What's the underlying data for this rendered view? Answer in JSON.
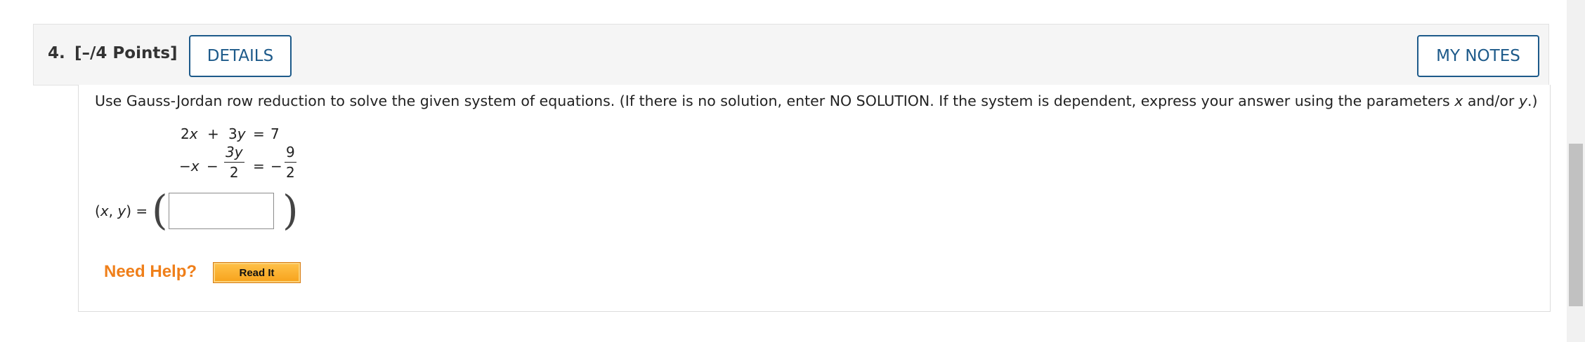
{
  "question": {
    "number": "4.",
    "points": "[–/4 Points]",
    "details_label": "DETAILS",
    "my_notes_label": "MY NOTES",
    "prompt_part1": "Use Gauss-Jordan row reduction to solve the given system of equations. (If there is no solution, enter NO SOLUTION. If the system is dependent, express your answer using the parameters ",
    "param_x": "x",
    "prompt_and_or": " and/or ",
    "param_y": "y",
    "prompt_end": ".)"
  },
  "system": {
    "eq1": {
      "c1": "2",
      "v1": "x",
      "op": "+",
      "c2": "3",
      "v2": "y",
      "eq": "=",
      "rhs": "7"
    },
    "eq2": {
      "lhs_prefix": "−",
      "v1": "x",
      "op": "−",
      "frac1_num": "3y",
      "frac1_den": "2",
      "eq": "=",
      "rhs_sign": "−",
      "frac2_num": "9",
      "frac2_den": "2"
    }
  },
  "answer": {
    "label_open": "(",
    "label_x": "x",
    "label_comma": ", ",
    "label_y": "y",
    "label_close": ") =",
    "value": "",
    "paren_open": "(",
    "paren_close": ")"
  },
  "help": {
    "need_help_label": "Need Help?",
    "read_it_label": "Read It"
  },
  "colors": {
    "accent": "#1d5a8a",
    "help": "#ef7f1a",
    "read_it_button": "#f7a21b"
  }
}
